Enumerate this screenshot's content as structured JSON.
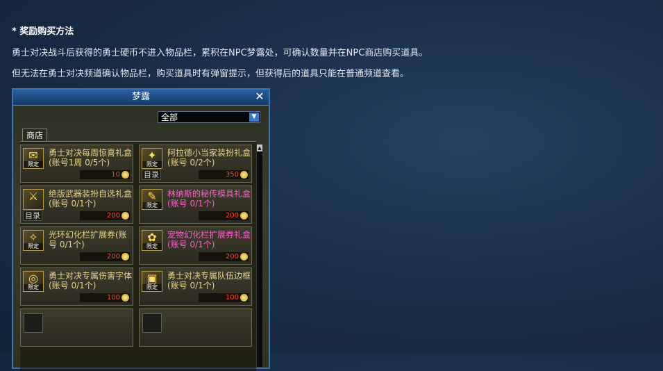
{
  "intro": {
    "heading": "* 奖励购买方法",
    "line1": "勇士对决战斗后获得的勇士硬币不进入物品栏，累积在NPC梦露处，可确认数量并在NPC商店购买道具。",
    "line2": "但无法在勇士对决频道确认物品栏，购买道具时有弹窗提示，但获得后的道具只能在普通频道查看。"
  },
  "window": {
    "title": "梦露",
    "close_icon": "close-icon",
    "filter": {
      "value": "全部",
      "arrow_icon": "chevron-down-icon"
    },
    "tab": "商店",
    "scroll_up_icon": "scroll-up-icon"
  },
  "items": [
    {
      "name": "勇士对决每周惊喜礼盒(账号1周 0/5个)",
      "badge": "限定",
      "price": "10",
      "color": "gold",
      "catalog": ""
    },
    {
      "name": "阿拉德小当家装扮礼盒(账号 0/2个)",
      "badge": "限定",
      "price": "350",
      "color": "gold",
      "catalog": "目录"
    },
    {
      "name": "绝版武器装扮自选礼盒(账号 0/1个)",
      "badge": "",
      "price": "200",
      "color": "gold",
      "catalog": "目录"
    },
    {
      "name": "林纳斯的秘传模具礼盒(账号 0/1个)",
      "badge": "限定",
      "price": "200",
      "color": "pink",
      "catalog": ""
    },
    {
      "name": "光环幻化栏扩展券(账号 0/1个)",
      "badge": "限定",
      "price": "200",
      "color": "gold",
      "catalog": ""
    },
    {
      "name": "宠物幻化栏扩展券礼盒(账号 0/1个)",
      "badge": "限定",
      "price": "200",
      "color": "pink",
      "catalog": ""
    },
    {
      "name": "勇士对决专属伤害字体(账号 0/1个)",
      "badge": "限定",
      "price": "100",
      "color": "gold",
      "catalog": ""
    },
    {
      "name": "勇士对决专属队伍边框(账号 0/1个)",
      "badge": "限定",
      "price": "100",
      "color": "gold",
      "catalog": ""
    }
  ],
  "coin_icon": "coin-icon",
  "colors": {
    "gold": "#e8d18f",
    "pink": "#ff5fd0",
    "price": "#ff4a3a",
    "accent": "#3a73b8"
  }
}
